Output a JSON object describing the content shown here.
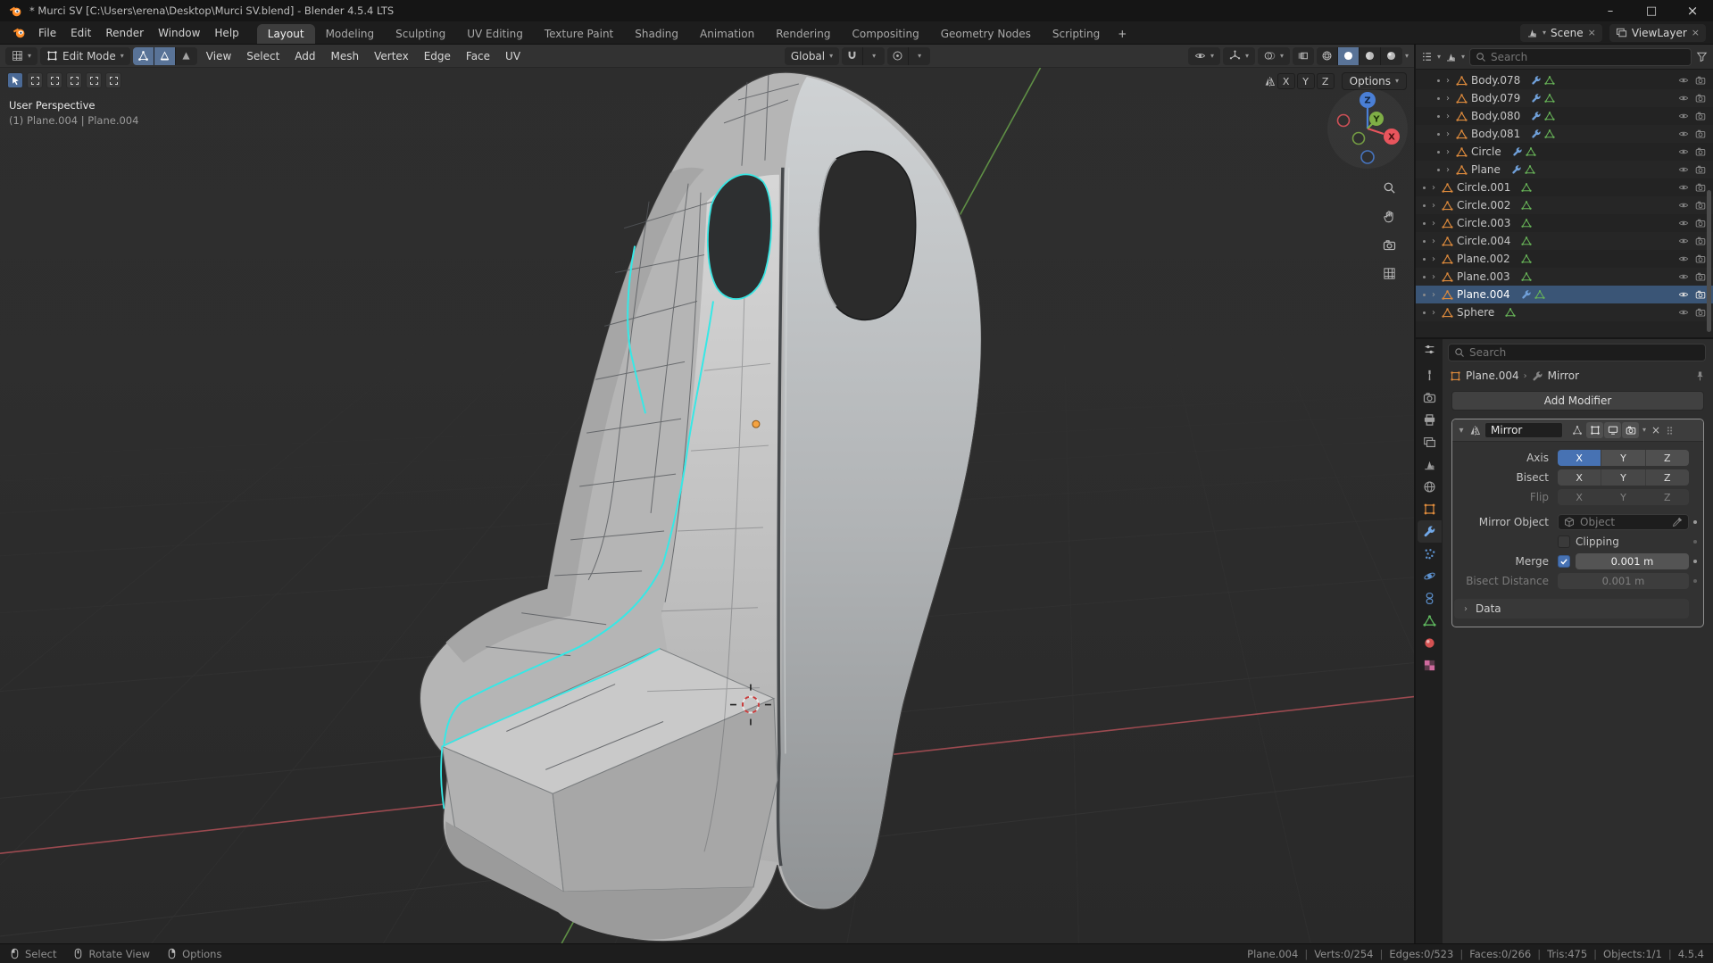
{
  "icons": {
    "chevron_down": "▾",
    "expand": "›",
    "crumb_sep": "›",
    "close": "×",
    "minimize": "–",
    "maximize": "□",
    "plus": "+",
    "panel_open": "▾",
    "panel_closed": "›"
  },
  "titlebar": {
    "title": "* Murci SV [C:\\Users\\erena\\Desktop\\Murci SV.blend] - Blender 4.5.4 LTS"
  },
  "topbar": {
    "menus": [
      "File",
      "Edit",
      "Render",
      "Window",
      "Help"
    ],
    "workspaces": [
      "Layout",
      "Modeling",
      "Sculpting",
      "UV Editing",
      "Texture Paint",
      "Shading",
      "Animation",
      "Rendering",
      "Compositing",
      "Geometry Nodes",
      "Scripting"
    ],
    "scene": "Scene",
    "viewlayer": "ViewLayer"
  },
  "viewport": {
    "header": {
      "mode": "Edit Mode",
      "menus": [
        "View",
        "Select",
        "Add",
        "Mesh",
        "Vertex",
        "Edge",
        "Face",
        "UV"
      ],
      "orientation": "Global",
      "mirror_axes": [
        "X",
        "Y",
        "Z"
      ],
      "options_label": "Options"
    },
    "overlay": {
      "perspective": "User Perspective",
      "object_info": "(1) Plane.004 | Plane.004"
    },
    "gizmo": {
      "x": "X",
      "y": "Y",
      "z": "Z"
    }
  },
  "outliner": {
    "search_placeholder": "Search",
    "items": [
      {
        "name": "Body.078"
      },
      {
        "name": "Body.079"
      },
      {
        "name": "Body.080"
      },
      {
        "name": "Body.081"
      },
      {
        "name": "Circle"
      },
      {
        "name": "Plane"
      },
      {
        "name": "Circle.001"
      },
      {
        "name": "Circle.002"
      },
      {
        "name": "Circle.003"
      },
      {
        "name": "Circle.004"
      },
      {
        "name": "Plane.002"
      },
      {
        "name": "Plane.003"
      },
      {
        "name": "Plane.004"
      },
      {
        "name": "Sphere"
      }
    ]
  },
  "properties": {
    "search_placeholder": "Search",
    "breadcrumb": {
      "object": "Plane.004",
      "modifier": "Mirror"
    },
    "add_modifier_label": "Add Modifier",
    "modifier": {
      "name": "Mirror",
      "axis_label": "Axis",
      "bisect_label": "Bisect",
      "flip_label": "Flip",
      "axes": [
        "X",
        "Y",
        "Z"
      ],
      "mirror_object_label": "Mirror Object",
      "mirror_object_placeholder": "Object",
      "clipping_label": "Clipping",
      "merge_label": "Merge",
      "merge_value": "0.001 m",
      "bisect_distance_label": "Bisect Distance",
      "bisect_distance_value": "0.001 m",
      "data_label": "Data"
    }
  },
  "statusbar": {
    "hints": [
      "Select",
      "Rotate View",
      "Options"
    ],
    "stats": [
      "Plane.004",
      "Verts:0/254",
      "Edges:0/523",
      "Faces:0/266",
      "Tris:475",
      "Objects:1/1",
      "4.5.4"
    ]
  }
}
